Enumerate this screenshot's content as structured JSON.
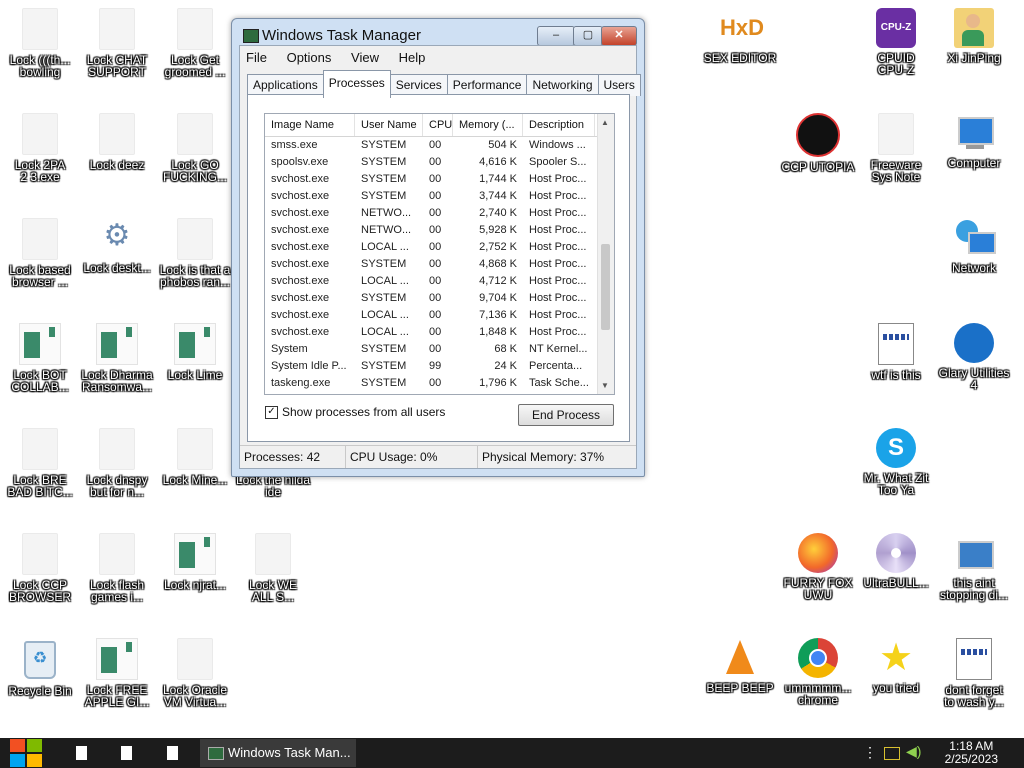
{
  "desktop": {
    "left_icons": [
      {
        "label": "Lock (((th...\nbowling"
      },
      {
        "label": "Lock CHAT\nSUPPORT"
      },
      {
        "label": "Lock Get\ngroomed ..."
      },
      {
        "label": "Lock 2PA\n2 3.exe"
      },
      {
        "label": "Lock deez"
      },
      {
        "label": "Lock GO\nFUCKING..."
      },
      {
        "label": "Lock based\nbrowser ..."
      },
      {
        "label": "Lock deskt..."
      },
      {
        "label": "Lock is that a\nphobos ran..."
      },
      {
        "label": "Lock BOT\nCOLLAB..."
      },
      {
        "label": "Lock Dharma\nRansomwa..."
      },
      {
        "label": "Lock Lime"
      },
      {
        "label": "Lock BRE\nBAD BITC..."
      },
      {
        "label": "Lock dnspy\nbut for n..."
      },
      {
        "label": "Lock Mine..."
      },
      {
        "label": "Lock the hilda\nide"
      },
      {
        "label": "Lock CCP\nBROWSER"
      },
      {
        "label": "Lock flash\ngames i..."
      },
      {
        "label": "Lock njrat..."
      },
      {
        "label": "Lock WE\nALL S..."
      },
      {
        "label": "Recycle Bin"
      },
      {
        "label": "Lock FREE\nAPPLE GI..."
      },
      {
        "label": "Lock Oracle\nVM Virtua..."
      }
    ],
    "right_icons": [
      {
        "label": "SEX EDITOR"
      },
      {
        "label": "CPUID\nCPU-Z"
      },
      {
        "label": "Xi JinPing"
      },
      {
        "label": "CCP UTOPIA"
      },
      {
        "label": "Freeware\nSys Note"
      },
      {
        "label": "Computer"
      },
      {
        "label": "Network"
      },
      {
        "label": "wtf is this"
      },
      {
        "label": "Glary Utilities\n4"
      },
      {
        "label": "Mr. What Zit\nToo Ya"
      },
      {
        "label": "FURRY FOX\nUWU"
      },
      {
        "label": "UltraBULL..."
      },
      {
        "label": "this aint\nstopping di..."
      },
      {
        "label": "BEEP BEEP"
      },
      {
        "label": "ummmmm...\nchrome"
      },
      {
        "label": "you tried"
      },
      {
        "label": "dont forget\nto wash y..."
      }
    ],
    "cpuz_icon_text": "CPU-Z",
    "hxd_icon_text": "HxD"
  },
  "taskmanager": {
    "title": "Windows Task Manager",
    "btn_min": "–",
    "btn_max": "▢",
    "btn_close": "✕",
    "menu": [
      "File",
      "Options",
      "View",
      "Help"
    ],
    "tabs": [
      "Applications",
      "Processes",
      "Services",
      "Performance",
      "Networking",
      "Users"
    ],
    "columns": [
      "Image Name",
      "User Name",
      "CPU",
      "Memory (...",
      "Description"
    ],
    "rows": [
      [
        "smss.exe",
        "SYSTEM",
        "00",
        "504 K",
        "Windows ..."
      ],
      [
        "spoolsv.exe",
        "SYSTEM",
        "00",
        "4,616 K",
        "Spooler S..."
      ],
      [
        "svchost.exe",
        "SYSTEM",
        "00",
        "1,744 K",
        "Host Proc..."
      ],
      [
        "svchost.exe",
        "SYSTEM",
        "00",
        "3,744 K",
        "Host Proc..."
      ],
      [
        "svchost.exe",
        "NETWO...",
        "00",
        "2,740 K",
        "Host Proc..."
      ],
      [
        "svchost.exe",
        "NETWO...",
        "00",
        "5,928 K",
        "Host Proc..."
      ],
      [
        "svchost.exe",
        "LOCAL ...",
        "00",
        "2,752 K",
        "Host Proc..."
      ],
      [
        "svchost.exe",
        "SYSTEM",
        "00",
        "4,868 K",
        "Host Proc..."
      ],
      [
        "svchost.exe",
        "LOCAL ...",
        "00",
        "4,712 K",
        "Host Proc..."
      ],
      [
        "svchost.exe",
        "SYSTEM",
        "00",
        "9,704 K",
        "Host Proc..."
      ],
      [
        "svchost.exe",
        "LOCAL ...",
        "00",
        "7,136 K",
        "Host Proc..."
      ],
      [
        "svchost.exe",
        "LOCAL ...",
        "00",
        "1,848 K",
        "Host Proc..."
      ],
      [
        "System",
        "SYSTEM",
        "00",
        "68 K",
        "NT Kernel..."
      ],
      [
        "System Idle P...",
        "SYSTEM",
        "99",
        "24 K",
        "Percenta..."
      ],
      [
        "taskeng.exe",
        "SYSTEM",
        "00",
        "1,796 K",
        "Task Sche..."
      ]
    ],
    "show_all_label": "Show processes from all users",
    "show_all_checked": "✓",
    "end_process_label": "End Process",
    "status": {
      "processes": "Processes: 42",
      "cpu": "CPU Usage: 0%",
      "memory": "Physical Memory: 37%"
    }
  },
  "taskbar": {
    "active_window": "Windows Task Man...",
    "time": "1:18 AM",
    "date": "2/25/2023"
  }
}
